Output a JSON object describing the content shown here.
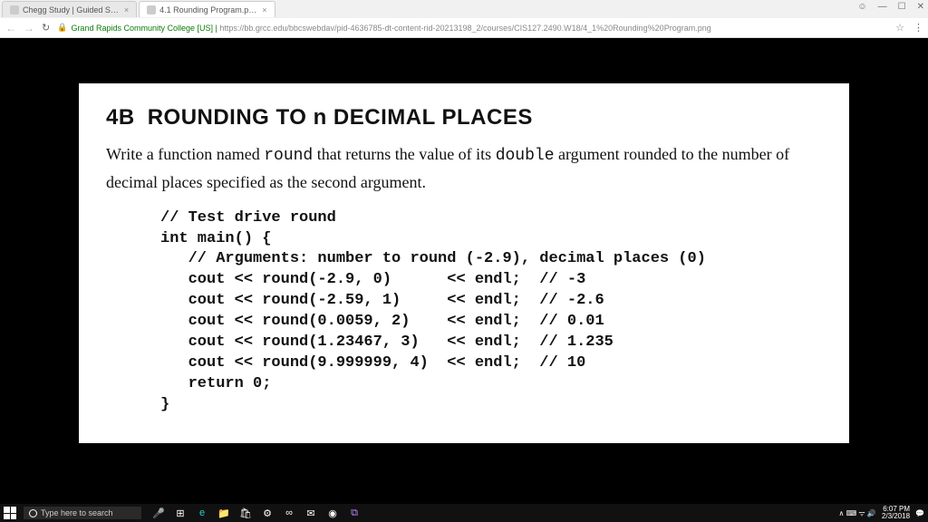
{
  "browser": {
    "tabs": [
      {
        "title": "Chegg Study | Guided S…"
      },
      {
        "title": "4.1 Rounding Program.p…"
      }
    ],
    "windowControls": {
      "user": "☺",
      "min": "—",
      "max": "☐",
      "close": "✕"
    },
    "nav": {
      "back": "←",
      "fwd": "→",
      "reload": "↻"
    },
    "url": {
      "lock": "🔒",
      "host": "Grand Rapids Community College [US]",
      "sep": " | ",
      "base": "https://bb.grcc.edu",
      "path": "/bbcswebdav/pid-4636785-dt-content-rid-20213198_2/courses/CIS127.2490.W18/4_1%20Rounding%20Program.png"
    },
    "star": "☆",
    "menu": "⋮"
  },
  "doc": {
    "heading_num": "4B",
    "heading_a": "ROUNDING TO ",
    "heading_n": "n",
    "heading_b": " DECIMAL PLACES",
    "p1a": "Write a function named ",
    "p1_round": "round",
    "p1b": " that returns the value of its ",
    "p1_double": "double",
    "p1c": " argument rounded to the number of decimal places specified as the second argument.",
    "code": "// Test drive round\nint main() {\n   // Arguments: number to round (-2.9), decimal places (0)\n   cout << round(-2.9, 0)      << endl;  // -3\n   cout << round(-2.59, 1)     << endl;  // -2.6\n   cout << round(0.0059, 2)    << endl;  // 0.01\n   cout << round(1.23467, 3)   << endl;  // 1.235\n   cout << round(9.999999, 4)  << endl;  // 10\n   return 0;\n}"
  },
  "taskbar": {
    "search_placeholder": "Type here to search",
    "tray": "∧  ⌨  ᯤ  🔊",
    "time": "6:07 PM",
    "date": "2/3/2018"
  }
}
